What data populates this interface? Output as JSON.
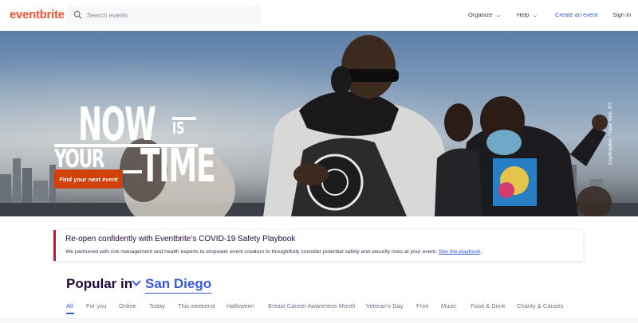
{
  "brand": {
    "logo_text": "eventbrite",
    "accent": "#f05537",
    "link": "#3659e3",
    "cta": "#d1410c"
  },
  "search": {
    "placeholder": "Search events",
    "icon": "search-icon"
  },
  "nav": {
    "organize": "Organize",
    "help": "Help",
    "create": "Create an event",
    "signin": "Sign In"
  },
  "hero": {
    "title_now": "NOW",
    "title_is": "IS",
    "title_your": "YOUR",
    "title_time": "TIME",
    "cta": "Find your next event",
    "credit": "Daybreaker / New York, NY"
  },
  "banner": {
    "title": "Re-open confidently with Eventbrite’s COVID-19 Safety Playbook",
    "body": "We partnered with risk management and health experts to empower event creators to thoughtfully consider potential safety and security risks at your event.",
    "link": "See the playbook",
    "tail": "."
  },
  "popular": {
    "label": "Popular in",
    "city": "San Diego"
  },
  "tabs": [
    {
      "label": "All",
      "active": true
    },
    {
      "label": "For you"
    },
    {
      "label": "Online"
    },
    {
      "label": "Today"
    },
    {
      "label": "This weekend"
    },
    {
      "label": "Halloween"
    },
    {
      "label": "Breast Cancer Awareness Month"
    },
    {
      "label": "Veteran’s Day"
    },
    {
      "label": "Free"
    },
    {
      "label": "Music"
    },
    {
      "label": "Food & Drink"
    },
    {
      "label": "Charity & Causes"
    }
  ]
}
